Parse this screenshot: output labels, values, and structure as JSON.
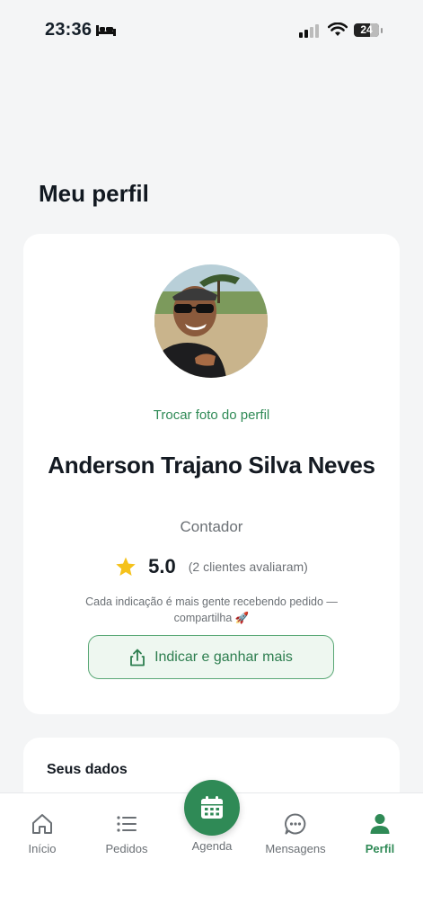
{
  "status_bar": {
    "time": "23:36",
    "battery": "24"
  },
  "page": {
    "title": "Meu perfil"
  },
  "profile": {
    "change_photo_label": "Trocar foto do perfil",
    "name": "Anderson Trajano Silva Neves",
    "role": "Contador",
    "rating_value": "5.0",
    "rating_count": "(2 clientes avaliaram)",
    "referral_text": "Cada indicação é mais gente recebendo pedido — compartilha 🚀",
    "referral_button_label": "Indicar e ganhar mais"
  },
  "data_section": {
    "title": "Seus dados"
  },
  "bottom_nav": {
    "items": [
      {
        "label": "Início",
        "icon": "home-icon"
      },
      {
        "label": "Pedidos",
        "icon": "list-icon"
      },
      {
        "label": "Agenda",
        "icon": "calendar-icon"
      },
      {
        "label": "Mensagens",
        "icon": "chat-icon"
      },
      {
        "label": "Perfil",
        "icon": "person-icon",
        "active": true
      }
    ]
  },
  "colors": {
    "accent": "#2f8a56",
    "star": "#f5c21b",
    "background": "#f4f5f6"
  }
}
